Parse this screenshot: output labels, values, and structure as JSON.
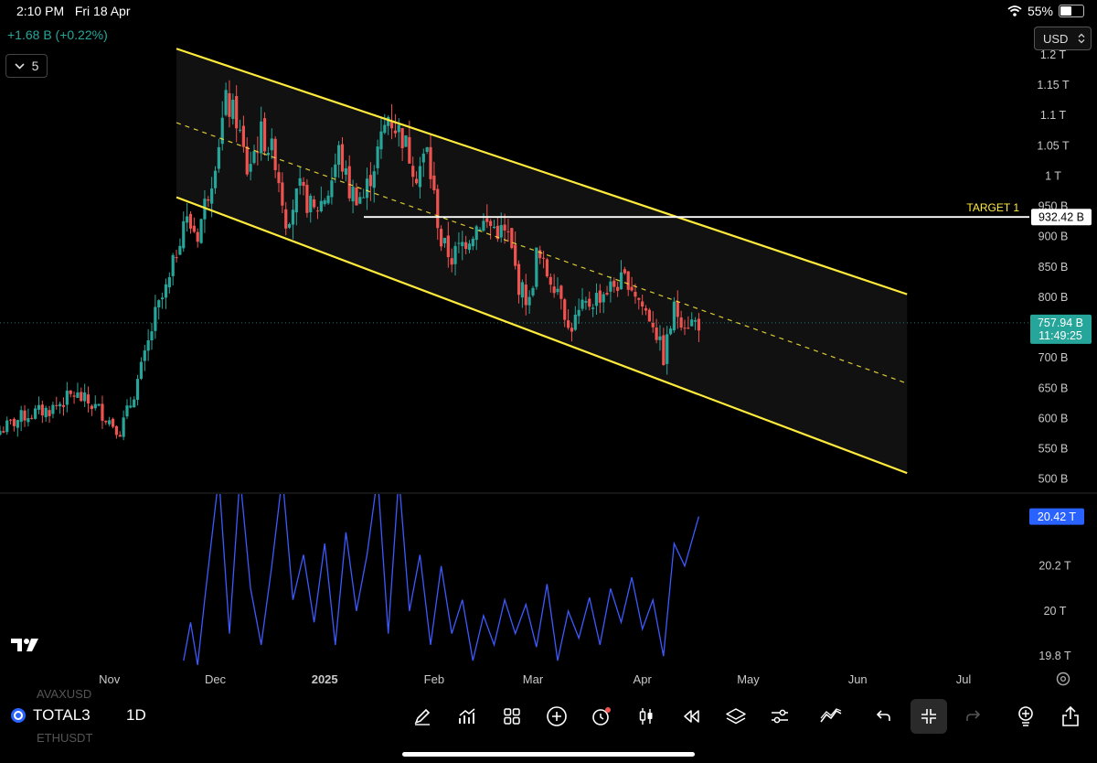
{
  "status_bar": {
    "time": "2:10 PM",
    "date": "Fri 18 Apr",
    "battery": "55%",
    "battery_level": 0.55
  },
  "header": {
    "change": "+1.68 B (+0.22%)",
    "indicator_count": "5",
    "currency": "USD"
  },
  "colors": {
    "up": "#26a69a",
    "down": "#ef5350",
    "channel": "#ffeb3b",
    "target_line": "#ffffff",
    "oscillator": "#3d5afe",
    "price_badge": "#26a69a",
    "osc_badge": "#2962ff"
  },
  "icons": [
    "draw-icon",
    "indicators-icon",
    "templates-icon",
    "add-icon",
    "alert-icon",
    "candle-type-icon",
    "replay-icon",
    "layers-icon",
    "settings-icon",
    "strategy-icon",
    "undo-icon",
    "collapse-icon",
    "redo-icon",
    "ideas-icon",
    "share-icon"
  ],
  "chart_data": {
    "type": "candlestick",
    "symbol": "TOTAL3",
    "interval": "1D",
    "x_ticks": [
      "Nov",
      "Dec",
      "2025",
      "Feb",
      "Mar",
      "Apr",
      "May",
      "Jun",
      "Jul"
    ],
    "y_ticks": [
      "1.2 T",
      "1.15 T",
      "1.1 T",
      "1.05 T",
      "1 T",
      "950 B",
      "900 B",
      "850 B",
      "800 B",
      "700 B",
      "650 B",
      "600 B",
      "550 B",
      "500 B"
    ],
    "y_range_billions": [
      480,
      1230
    ],
    "current_price": {
      "label": "757.94 B",
      "value": 757.94,
      "countdown": "11:49:25"
    },
    "target": {
      "label": "TARGET 1",
      "price_label": "932.42 B",
      "value": 932.42
    },
    "channel": {
      "upper": [
        [
          "2024-11-20",
          1210
        ],
        [
          "2025-06-15",
          805
        ]
      ],
      "lower": [
        [
          "2024-11-20",
          965
        ],
        [
          "2025-06-15",
          510
        ]
      ],
      "mid": [
        [
          "2024-11-20",
          1088
        ],
        [
          "2025-06-15",
          658
        ]
      ]
    },
    "price_path": [
      [
        "2024-10-01",
        580
      ],
      [
        "2024-10-08",
        605
      ],
      [
        "2024-10-15",
        615
      ],
      [
        "2024-10-22",
        640
      ],
      [
        "2024-10-29",
        615
      ],
      [
        "2024-11-04",
        580
      ],
      [
        "2024-11-07",
        625
      ],
      [
        "2024-11-11",
        700
      ],
      [
        "2024-11-14",
        770
      ],
      [
        "2024-11-18",
        825
      ],
      [
        "2024-11-22",
        930
      ],
      [
        "2024-11-26",
        905
      ],
      [
        "2024-11-30",
        1000
      ],
      [
        "2024-12-04",
        1120
      ],
      [
        "2024-12-07",
        1095
      ],
      [
        "2024-12-10",
        1010
      ],
      [
        "2024-12-14",
        1070
      ],
      [
        "2024-12-18",
        1030
      ],
      [
        "2024-12-21",
        930
      ],
      [
        "2024-12-25",
        975
      ],
      [
        "2024-12-29",
        940
      ],
      [
        "2025-01-02",
        975
      ],
      [
        "2025-01-05",
        1040
      ],
      [
        "2025-01-08",
        975
      ],
      [
        "2025-01-12",
        965
      ],
      [
        "2025-01-15",
        1020
      ],
      [
        "2025-01-19",
        1100
      ],
      [
        "2025-01-23",
        1065
      ],
      [
        "2025-01-27",
        1005
      ],
      [
        "2025-01-30",
        1040
      ],
      [
        "2025-02-03",
        890
      ],
      [
        "2025-02-06",
        865
      ],
      [
        "2025-02-10",
        895
      ],
      [
        "2025-02-14",
        925
      ],
      [
        "2025-02-18",
        915
      ],
      [
        "2025-02-22",
        900
      ],
      [
        "2025-02-25",
        820
      ],
      [
        "2025-02-28",
        790
      ],
      [
        "2025-03-02",
        870
      ],
      [
        "2025-03-05",
        840
      ],
      [
        "2025-03-09",
        810
      ],
      [
        "2025-03-11",
        745
      ],
      [
        "2025-03-15",
        780
      ],
      [
        "2025-03-19",
        800
      ],
      [
        "2025-03-24",
        820
      ],
      [
        "2025-03-28",
        830
      ],
      [
        "2025-04-01",
        785
      ],
      [
        "2025-04-04",
        760
      ],
      [
        "2025-04-07",
        700
      ],
      [
        "2025-04-10",
        780
      ],
      [
        "2025-04-13",
        760
      ],
      [
        "2025-04-17",
        758
      ]
    ],
    "oscillator": {
      "y_ticks": [
        "20.42 T",
        "20.2 T",
        "20 T",
        "19.8 T"
      ],
      "last_label": "20.42 T",
      "range_trillions": [
        19.76,
        20.52
      ],
      "values": [
        [
          "2024-11-22",
          19.78
        ],
        [
          "2024-11-24",
          19.95
        ],
        [
          "2024-11-26",
          19.76
        ],
        [
          "2024-11-28",
          20.05
        ],
        [
          "2024-12-02",
          20.6
        ],
        [
          "2024-12-05",
          19.9
        ],
        [
          "2024-12-08",
          20.6
        ],
        [
          "2024-12-11",
          20.1
        ],
        [
          "2024-12-14",
          19.85
        ],
        [
          "2024-12-17",
          20.2
        ],
        [
          "2024-12-20",
          20.6
        ],
        [
          "2024-12-23",
          20.05
        ],
        [
          "2024-12-26",
          20.25
        ],
        [
          "2024-12-29",
          19.95
        ],
        [
          "2025-01-01",
          20.3
        ],
        [
          "2025-01-04",
          19.85
        ],
        [
          "2025-01-07",
          20.35
        ],
        [
          "2025-01-10",
          20.0
        ],
        [
          "2025-01-13",
          20.25
        ],
        [
          "2025-01-16",
          20.6
        ],
        [
          "2025-01-19",
          19.9
        ],
        [
          "2025-01-22",
          20.6
        ],
        [
          "2025-01-25",
          20.0
        ],
        [
          "2025-01-28",
          20.25
        ],
        [
          "2025-01-31",
          19.85
        ],
        [
          "2025-02-03",
          20.2
        ],
        [
          "2025-02-06",
          19.9
        ],
        [
          "2025-02-09",
          20.05
        ],
        [
          "2025-02-12",
          19.78
        ],
        [
          "2025-02-15",
          19.98
        ],
        [
          "2025-02-18",
          19.85
        ],
        [
          "2025-02-21",
          20.05
        ],
        [
          "2025-02-24",
          19.9
        ],
        [
          "2025-02-27",
          20.03
        ],
        [
          "2025-03-02",
          19.84
        ],
        [
          "2025-03-05",
          20.12
        ],
        [
          "2025-03-08",
          19.78
        ],
        [
          "2025-03-11",
          20.0
        ],
        [
          "2025-03-14",
          19.88
        ],
        [
          "2025-03-17",
          20.06
        ],
        [
          "2025-03-20",
          19.85
        ],
        [
          "2025-03-23",
          20.1
        ],
        [
          "2025-03-26",
          19.95
        ],
        [
          "2025-03-29",
          20.15
        ],
        [
          "2025-04-01",
          19.92
        ],
        [
          "2025-04-04",
          20.05
        ],
        [
          "2025-04-07",
          19.8
        ],
        [
          "2025-04-10",
          20.3
        ],
        [
          "2025-04-13",
          20.2
        ],
        [
          "2025-04-17",
          20.42
        ]
      ]
    }
  },
  "bottom_bar": {
    "symbol": "TOTAL3",
    "interval": "1D",
    "ghost_above": "AVAXUSD",
    "ghost_below": "ETHUSDT"
  }
}
